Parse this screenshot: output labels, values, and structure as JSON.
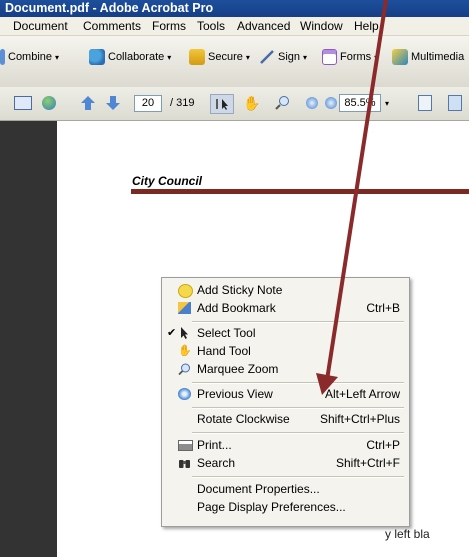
{
  "window": {
    "title": "Document.pdf - Adobe Acrobat Pro"
  },
  "menubar": {
    "items": [
      "Document",
      "Comments",
      "Forms",
      "Tools",
      "Advanced",
      "Window",
      "Help"
    ]
  },
  "tasks": {
    "items": [
      "Combine",
      "Collaborate",
      "Secure",
      "Sign",
      "Forms",
      "Multimedia"
    ],
    "dropdown_glyph": "▾"
  },
  "nav": {
    "page_number": "20",
    "page_total": "/ 319",
    "zoom": "85.5%"
  },
  "document": {
    "heading": "City Council",
    "body_fragment": "y left bla"
  },
  "context_menu": {
    "items": [
      {
        "label": "Add Sticky Note",
        "shortcut": "",
        "icon": "sticky-note-icon"
      },
      {
        "label": "Add Bookmark",
        "shortcut": "Ctrl+B",
        "icon": "bookmark-icon"
      },
      {
        "label": "Select Tool",
        "shortcut": "",
        "icon": "select-cursor-icon",
        "checked": true,
        "check_glyph": "✔"
      },
      {
        "label": "Hand Tool",
        "shortcut": "",
        "icon": "hand-icon"
      },
      {
        "label": "Marquee Zoom",
        "shortcut": "",
        "icon": "marquee-zoom-icon"
      },
      {
        "label": "Previous View",
        "shortcut": "Alt+Left Arrow",
        "icon": "previous-view-icon"
      },
      {
        "label": "Rotate Clockwise",
        "shortcut": "Shift+Ctrl+Plus",
        "icon": ""
      },
      {
        "label": "Print...",
        "shortcut": "Ctrl+P",
        "icon": "printer-icon"
      },
      {
        "label": "Search",
        "shortcut": "Shift+Ctrl+F",
        "icon": "binoculars-icon"
      },
      {
        "label": "Document Properties...",
        "shortcut": "",
        "icon": ""
      },
      {
        "label": "Page Display Preferences...",
        "shortcut": "",
        "icon": ""
      }
    ]
  },
  "annotation": {
    "arrow_color": "#8b2a2a"
  },
  "colors": {
    "title_bar": "#1e4f9c",
    "heading_rule": "#7b2a22",
    "left_panel": "#333333"
  }
}
